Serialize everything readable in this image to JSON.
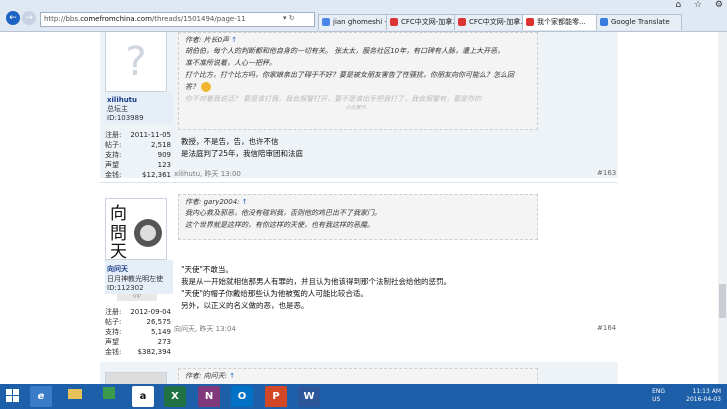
{
  "browser": {
    "url_prefix": "http://bbs.",
    "url_domain": "comefromchina.com",
    "url_path": "/threads/1501494/page-11",
    "tabs": [
      {
        "label": "jian ghomeshi - Go..."
      },
      {
        "label": "CFC中文网-加拿..."
      },
      {
        "label": "CFC中文网-加拿..."
      },
      {
        "label": "我个家都能零..."
      },
      {
        "label": "Google Translate"
      }
    ]
  },
  "post1": {
    "username": "xilihutu",
    "user_title": "总坛主",
    "user_id": "ID:103989",
    "stats": [
      {
        "k": "注册:",
        "v": "2011-11-05"
      },
      {
        "k": "帖子:",
        "v": "2,518"
      },
      {
        "k": "支持:",
        "v": "909"
      },
      {
        "k": "声望",
        "v": "123"
      },
      {
        "k": "金钱:",
        "v": "$12,361"
      }
    ],
    "quote_head": "作者: 片长0声",
    "quote_lines": [
      "胡伯伯，每个人的判断都和他自身的一切有关。 张太太，服务社区10年，有口碑有人脉，遭上大开恶，",
      "准不准所说着，人心一把秤。",
      "打个比方，打个比方吗，你家娘亲出了碍于不好？要是被女朋友害告了性骚扰，你朋友向你可能么？怎么回",
      "答？",
      "你不对着我说话？ 要是谁打我，我会报警打开，要不是谁出手把我打了，我会报警有，要是你的"
    ],
    "quote_tail": "点击展开...",
    "message": [
      "教授，不是告，告，也许不信",
      "是法庭判了25年，我信陪审团和法庭"
    ],
    "meta": "xilihutu, 昨天 13:00",
    "floor": "#163"
  },
  "post2": {
    "username": "向问天",
    "user_title": "日月神教光明左使",
    "user_id": "ID:112302",
    "vip": "VIP",
    "stats": [
      {
        "k": "注册:",
        "v": "2012-09-04"
      },
      {
        "k": "帖子:",
        "v": "26,575"
      },
      {
        "k": "支持:",
        "v": "5,149"
      },
      {
        "k": "声望",
        "v": "273"
      },
      {
        "k": "金钱:",
        "v": "$382,394"
      }
    ],
    "quote_head": "作者: gary2004:",
    "quote_lines": [
      "我内心救及邪恶，他没有碰到我，否则他的鸡巴出不了我家门。",
      "这个世界就是这样的，有你这样的天使，也有我这样的恶魔。"
    ],
    "message": [
      "\"天使\"不敢当。",
      "我是从一开始就相信那男人有罪的，并且认为他该得到那个法制社会给他的惩罚。",
      "\"天使\"的帽子你戴给那些认为他被冤的人可能比较合适。",
      "另外，以正义的名义做的恶，也是恶。"
    ],
    "meta": "向问天, 昨天 13:04",
    "floor": "#164"
  },
  "post3": {
    "quote_head": "作者: 向问天:"
  },
  "taskbar": {
    "lang": "ENG",
    "region": "US",
    "time": "11:13 AM",
    "date": "2016-04-03"
  }
}
